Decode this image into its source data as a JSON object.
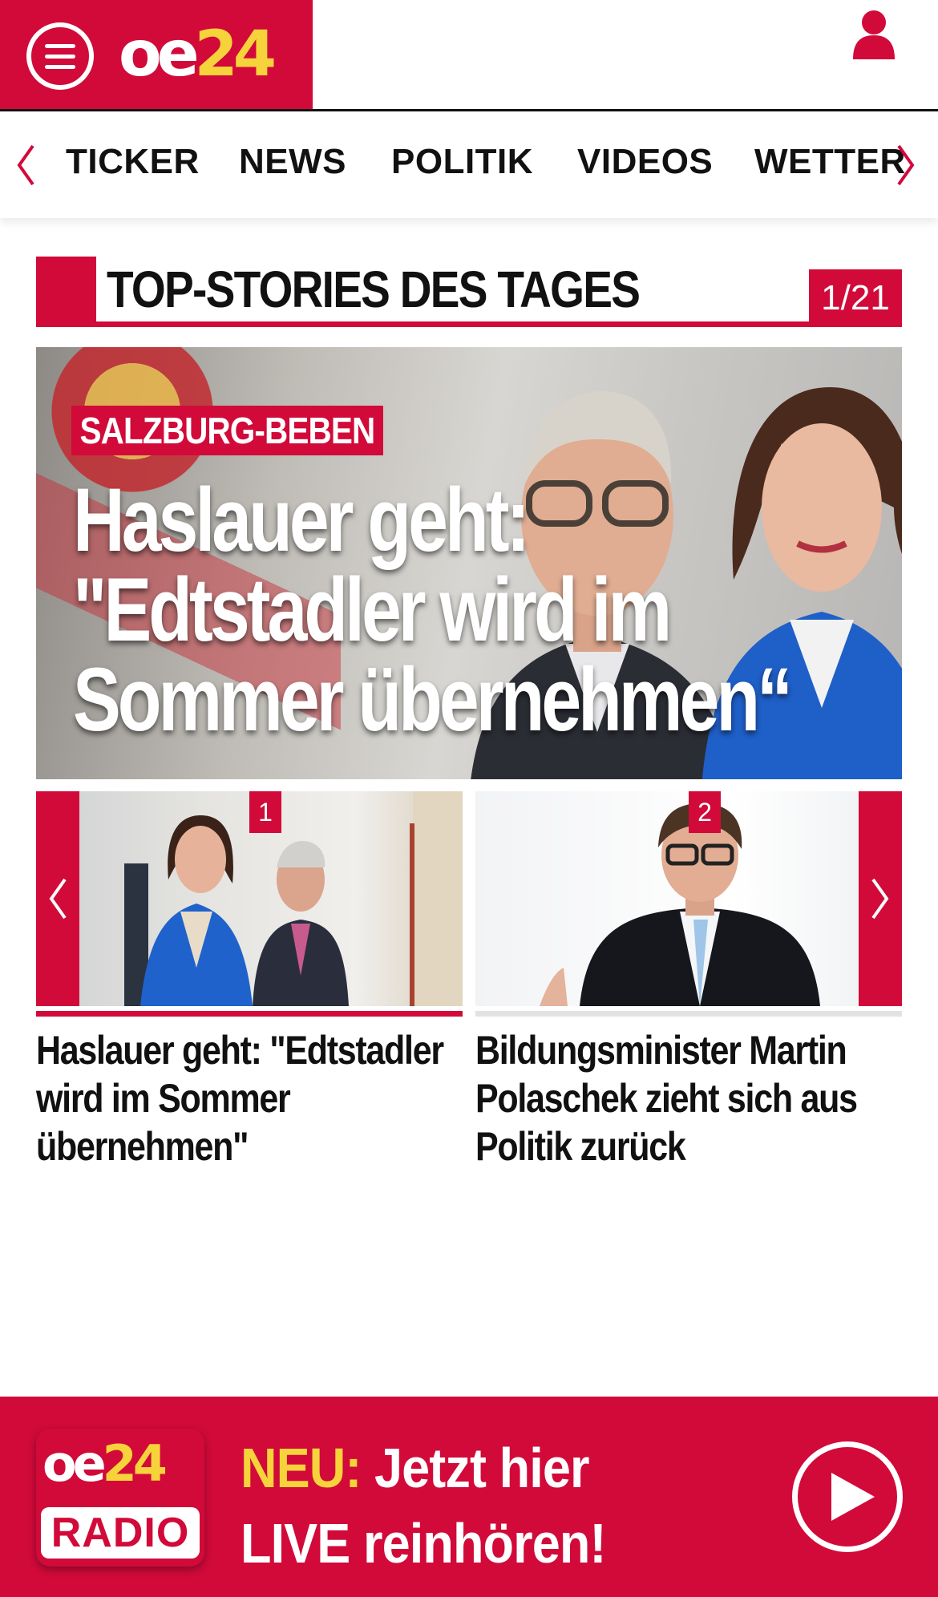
{
  "header": {
    "logo_main": "oe",
    "logo_num": "24",
    "menu_icon": "hamburger-menu-icon",
    "account_icon": "user-icon",
    "brand_color": "#d10a3a",
    "accent_color": "#f6d33a"
  },
  "nav": {
    "prev_icon": "chevron-left-icon",
    "next_icon": "chevron-right-icon",
    "items": [
      {
        "label": "TICKER"
      },
      {
        "label": "NEWS"
      },
      {
        "label": "POLITIK"
      },
      {
        "label": "VIDEOS"
      },
      {
        "label": "WETTER"
      }
    ]
  },
  "section": {
    "title": "TOP-STORIES DES TAGES",
    "counter": "1/21"
  },
  "hero": {
    "kicker": "SALZBURG-BEBEN",
    "title": "Haslauer geht:\n\"Edtstadler wird im\nSommer übernehmen“"
  },
  "carousel": {
    "prev_icon": "chevron-left-icon",
    "next_icon": "chevron-right-icon",
    "cards": [
      {
        "number": "1",
        "title": "Haslauer geht: \"Edtstadler wird im Sommer übernehmen\""
      },
      {
        "number": "2",
        "title": "Bildungsminister Martin Polaschek zieht sich aus Politik zurück"
      }
    ]
  },
  "radio_banner": {
    "logo_main": "oe",
    "logo_num": "24",
    "logo_label": "RADIO",
    "neu": "NEU:",
    "line1_rest": " Jetzt hier",
    "line2": "LIVE reinhören!",
    "play_icon": "play-icon"
  }
}
